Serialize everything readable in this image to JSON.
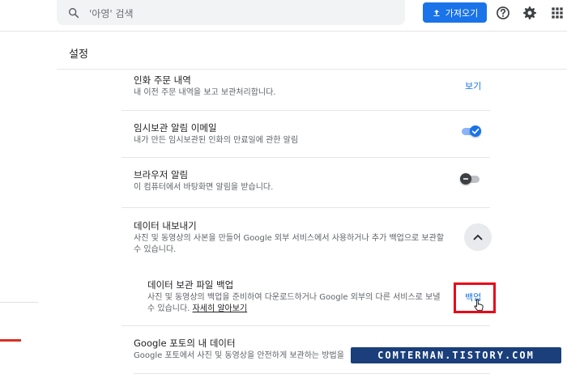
{
  "header": {
    "search_placeholder": "'아영' 검색",
    "import_label": "가져오기"
  },
  "page": {
    "title": "설정"
  },
  "rows": [
    {
      "title": "인화 주문 내역",
      "desc": "내 이전 주문 내역을 보고 보관처리합니다.",
      "action": "보기"
    },
    {
      "title": "임시보관 알림 이메일",
      "desc": "내가 만든 임시보관된 인화의 만료일에 관한 알림",
      "toggle_on": true
    },
    {
      "title": "브라우저 알림",
      "desc": "이 컴퓨터에서 바탕화면 알림을 받습니다.",
      "toggle_on": false
    },
    {
      "title": "데이터 내보내기",
      "desc": "사진 및 동영상의 사본을 만들어 Google 외부 서비스에서 사용하거나 추가 백업으로 보관할 수 있습니다."
    },
    {
      "title": "데이터 보관 파일 백업",
      "desc": "사진 및 동영상의 백업을 준비하여 다운로드하거나 Google 외부의 다른 서비스로 보낼 수 있습니다.",
      "desc_link": "자세히 알아보기",
      "action": "백업"
    },
    {
      "title": "Google 포토의 내 데이터",
      "desc": "Google 포토에서 사진 및 동영상을 안전하게 보관하는 방법을"
    }
  ],
  "watermark": "COMTERMAN.TISTORY.COM",
  "colors": {
    "accent": "#1a73e8",
    "highlight": "#e8071a",
    "watermark_bg": "#1a3f7a"
  }
}
